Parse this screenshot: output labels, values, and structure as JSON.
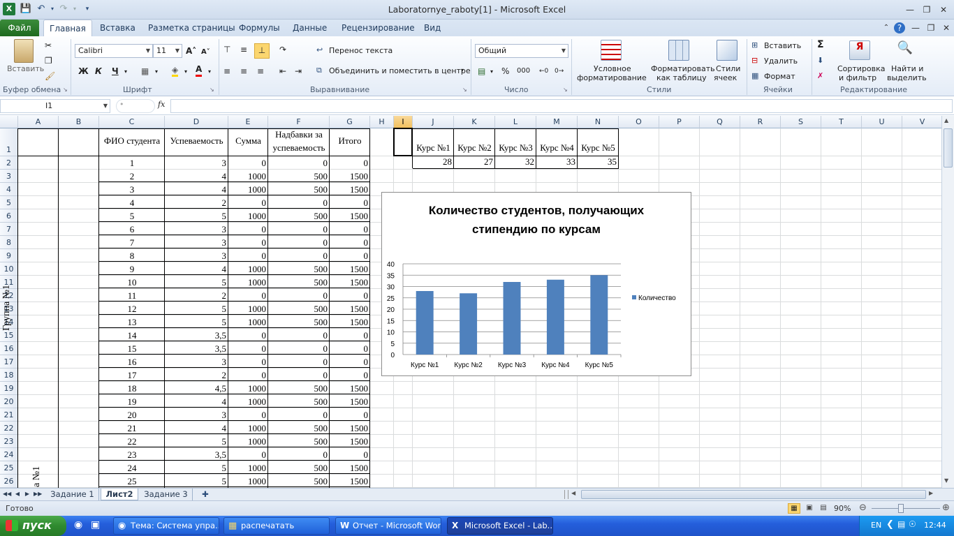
{
  "window": {
    "title": "Laboratornye_raboty[1]  -  Microsoft Excel"
  },
  "ribbon_tabs": [
    "Файл",
    "Главная",
    "Вставка",
    "Разметка страницы",
    "Формулы",
    "Данные",
    "Рецензирование",
    "Вид"
  ],
  "ribbon": {
    "clipboard": {
      "paste": "Вставить",
      "group": "Буфер обмена"
    },
    "font": {
      "name": "Calibri",
      "size": "11",
      "bold": "Ж",
      "italic": "К",
      "underline": "Ч",
      "group": "Шрифт"
    },
    "alignment": {
      "wrap": "Перенос текста",
      "merge": "Объединить и поместить в центре",
      "group": "Выравнивание"
    },
    "number": {
      "format": "Общий",
      "percent": "%",
      "thousands": "000",
      "group": "Число"
    },
    "styles": {
      "conditional": "Условное",
      "conditional2": "форматирование",
      "table": "Форматировать",
      "table2": "как таблицу",
      "cell": "Стили",
      "cell2": "ячеек",
      "group": "Стили"
    },
    "cells": {
      "insert": "Вставить",
      "delete": "Удалить",
      "format": "Формат",
      "group": "Ячейки"
    },
    "editing": {
      "sum": "Σ",
      "sort": "Сортировка",
      "sort2": "и фильтр",
      "find": "Найти и",
      "find2": "выделить",
      "group": "Редактирование"
    }
  },
  "formula_bar": {
    "name_box": "I1",
    "fx": "fx",
    "formula": ""
  },
  "columns": [
    "A",
    "B",
    "C",
    "D",
    "E",
    "F",
    "G",
    "H",
    "I",
    "J",
    "K",
    "L",
    "M",
    "N",
    "O",
    "P",
    "Q",
    "R",
    "S",
    "T",
    "U",
    "V"
  ],
  "rows": [
    "1",
    "2",
    "3",
    "4",
    "5",
    "6",
    "7",
    "8",
    "9",
    "10",
    "11",
    "12",
    "13",
    "14",
    "15",
    "16",
    "17",
    "18",
    "19",
    "20",
    "21",
    "22",
    "23",
    "24",
    "25",
    "26"
  ],
  "table_header": {
    "fio": "ФИО студента",
    "perf": "Успеваемость",
    "sum": "Сумма",
    "bonus1": "Надбавки за",
    "bonus2": "успеваемость",
    "total": "Итого"
  },
  "group_label": "Группа №1",
  "group_label_2": "а №1",
  "table_rows": [
    [
      "1",
      "3",
      "0",
      "0",
      "0"
    ],
    [
      "2",
      "4",
      "1000",
      "500",
      "1500"
    ],
    [
      "3",
      "4",
      "1000",
      "500",
      "1500"
    ],
    [
      "4",
      "2",
      "0",
      "0",
      "0"
    ],
    [
      "5",
      "5",
      "1000",
      "500",
      "1500"
    ],
    [
      "6",
      "3",
      "0",
      "0",
      "0"
    ],
    [
      "7",
      "3",
      "0",
      "0",
      "0"
    ],
    [
      "8",
      "3",
      "0",
      "0",
      "0"
    ],
    [
      "9",
      "4",
      "1000",
      "500",
      "1500"
    ],
    [
      "10",
      "5",
      "1000",
      "500",
      "1500"
    ],
    [
      "11",
      "2",
      "0",
      "0",
      "0"
    ],
    [
      "12",
      "5",
      "1000",
      "500",
      "1500"
    ],
    [
      "13",
      "5",
      "1000",
      "500",
      "1500"
    ],
    [
      "14",
      "3,5",
      "0",
      "0",
      "0"
    ],
    [
      "15",
      "3,5",
      "0",
      "0",
      "0"
    ],
    [
      "16",
      "3",
      "0",
      "0",
      "0"
    ],
    [
      "17",
      "2",
      "0",
      "0",
      "0"
    ],
    [
      "18",
      "4,5",
      "1000",
      "500",
      "1500"
    ],
    [
      "19",
      "4",
      "1000",
      "500",
      "1500"
    ],
    [
      "20",
      "3",
      "0",
      "0",
      "0"
    ],
    [
      "21",
      "4",
      "1000",
      "500",
      "1500"
    ],
    [
      "22",
      "5",
      "1000",
      "500",
      "1500"
    ],
    [
      "23",
      "3,5",
      "0",
      "0",
      "0"
    ],
    [
      "24",
      "5",
      "1000",
      "500",
      "1500"
    ],
    [
      "25",
      "5",
      "1000",
      "500",
      "1500"
    ]
  ],
  "course_headers": [
    "Курс №1",
    "Курс №2",
    "Курс №3",
    "Курс №4",
    "Курс №5"
  ],
  "course_values": [
    "28",
    "27",
    "32",
    "33",
    "35"
  ],
  "chart_data": {
    "type": "bar",
    "title": "Количество студентов, получающих стипендию по курсам",
    "title_line1": "Количество студентов, получающих",
    "title_line2": "стипендию по курсам",
    "categories": [
      "Курс №1",
      "Курс №2",
      "Курс №3",
      "Курс №4",
      "Курс №5"
    ],
    "series": [
      {
        "name": "Количество",
        "values": [
          28,
          27,
          32,
          33,
          35
        ]
      }
    ],
    "ylim": [
      0,
      40
    ],
    "yticks": [
      "0",
      "5",
      "10",
      "15",
      "20",
      "25",
      "30",
      "35",
      "40"
    ],
    "grid": true,
    "legend": "right",
    "bar_color": "#4f81bd"
  },
  "sheet_tabs": [
    "Задание 1",
    "Лист2",
    "Задание 3"
  ],
  "status": {
    "ready": "Готово",
    "zoom": "90%"
  },
  "taskbar": {
    "start": "пуск",
    "items": [
      "Тема: Система упра...",
      "распечатать",
      "Отчет - Microsoft Word",
      "Microsoft Excel - Lab..."
    ],
    "lang": "EN",
    "clock": "12:44"
  }
}
